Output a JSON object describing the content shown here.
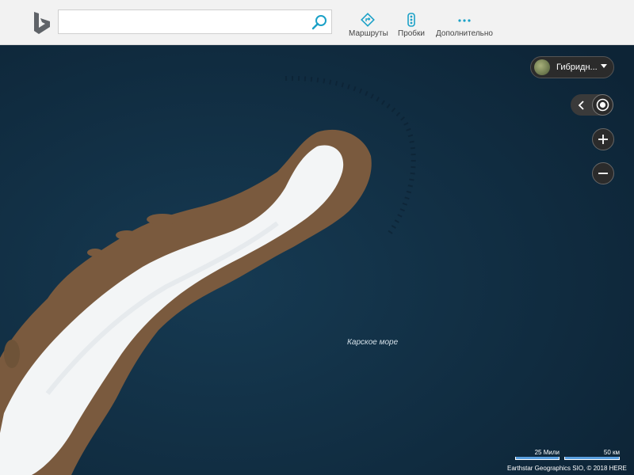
{
  "header": {
    "search": {
      "value": "",
      "placeholder": ""
    },
    "nav": [
      {
        "label": "Маршруты",
        "icon": "directions-icon"
      },
      {
        "label": "Пробки",
        "icon": "traffic-icon"
      },
      {
        "label": "Дополнительно",
        "icon": "more-icon"
      }
    ],
    "accent_color": "#1ba1c7"
  },
  "map": {
    "sea_label": "Карское море",
    "style_selector": {
      "label": "Гибридн...",
      "icon": "hybrid-thumbnail-icon"
    },
    "scale": {
      "miles_label": "25 Мили",
      "km_label": "50 км"
    },
    "attribution": "Earthstar Geographics SIO, © 2018 HERE"
  }
}
